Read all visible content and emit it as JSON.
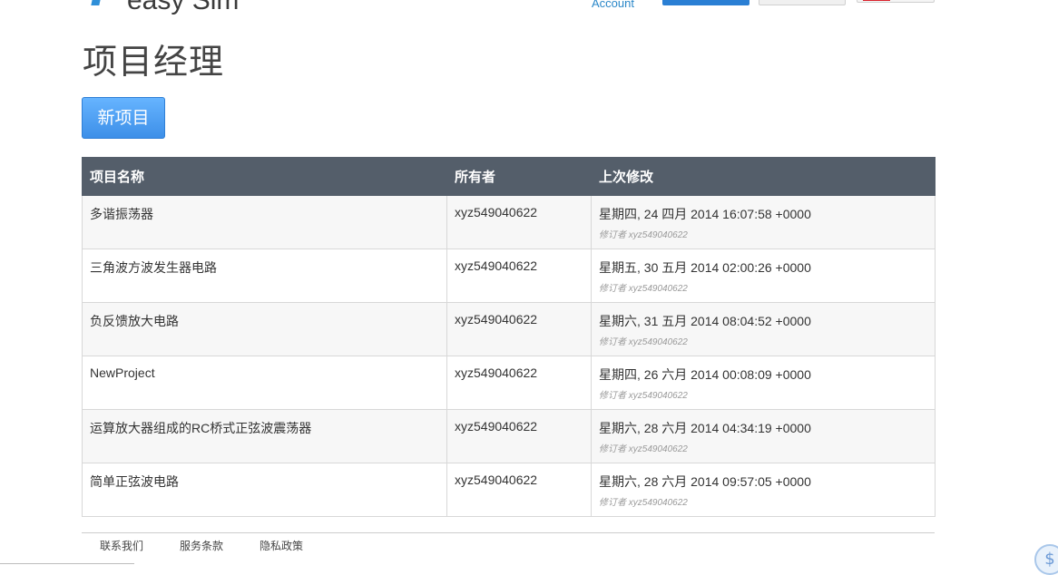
{
  "header": {
    "logo_text": "easy Sim",
    "account_label": "Account"
  },
  "page_title": "项目经理",
  "new_project_label": "新项目",
  "table": {
    "headers": [
      "项目名称",
      "所有者",
      "上次修改"
    ],
    "rows": [
      {
        "name": "多谐振荡器",
        "owner": "xyz549040622",
        "modified": "星期四, 24 四月 2014 16:07:58 +0000",
        "revised_by": "修订者 xyz549040622"
      },
      {
        "name": "三角波方波发生器电路",
        "owner": "xyz549040622",
        "modified": "星期五, 30 五月 2014 02:00:26 +0000",
        "revised_by": "修订者 xyz549040622"
      },
      {
        "name": "负反馈放大电路",
        "owner": "xyz549040622",
        "modified": "星期六, 31 五月 2014 08:04:52 +0000",
        "revised_by": "修订者 xyz549040622"
      },
      {
        "name": "NewProject",
        "owner": "xyz549040622",
        "modified": "星期四, 26 六月 2014 00:08:09 +0000",
        "revised_by": "修订者 xyz549040622"
      },
      {
        "name": "运算放大器组成的RC桥式正弦波震荡器",
        "owner": "xyz549040622",
        "modified": "星期六, 28 六月 2014 04:34:19 +0000",
        "revised_by": "修订者 xyz549040622"
      },
      {
        "name": "简单正弦波电路",
        "owner": "xyz549040622",
        "modified": "星期六, 28 六月 2014 09:57:05 +0000",
        "revised_by": "修订者 xyz549040622"
      }
    ]
  },
  "footer": {
    "links": [
      "联系我们",
      "服务条款",
      "隐私政策"
    ]
  },
  "help_icon": "dollar-help-icon",
  "colors": {
    "header_bg": "#545e6a",
    "accent": "#3d8fe8",
    "link": "#2a87c8"
  }
}
